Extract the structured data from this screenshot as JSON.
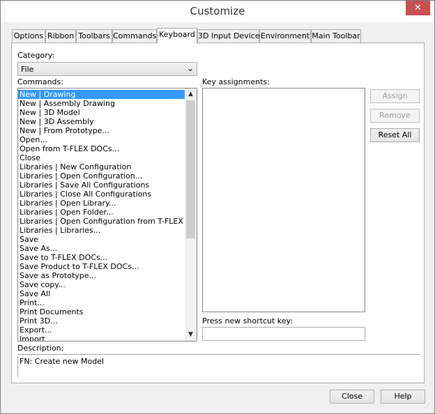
{
  "window": {
    "title": "Customize",
    "close_glyph": "✕"
  },
  "tabs": [
    {
      "label": "Options"
    },
    {
      "label": "Ribbon"
    },
    {
      "label": "Toolbars"
    },
    {
      "label": "Commands"
    },
    {
      "label": "Keyboard"
    },
    {
      "label": "3D Input Device"
    },
    {
      "label": "Environment"
    },
    {
      "label": "Main Toolbar"
    }
  ],
  "active_tab": "Keyboard",
  "category": {
    "label": "Category:",
    "value": "File"
  },
  "commands": {
    "label": "Commands:",
    "items": [
      "New | Drawing",
      "New | Assembly Drawing",
      "New | 3D Model",
      "New | 3D Assembly",
      "New | From Prototype...",
      "Open...",
      "Open from T-FLEX DOCs...",
      "Close",
      "Libraries | New Configuration",
      "Libraries | Open Configuration...",
      "Libraries | Save All Configurations",
      "Libraries | Close All Configurations",
      "Libraries | Open Library...",
      "Libraries | Open Folder...",
      "Libraries | Open Configuration from T-FLEX DOCs",
      "Libraries | Libraries...",
      "Save",
      "Save As...",
      "Save to T-FLEX DOCs...",
      "Save Product to T-FLEX DOCs...",
      "Save as Prototype...",
      "Save copy...",
      "Save All",
      "Print...",
      "Print Documents",
      "Print 3D...",
      "Export...",
      "Import"
    ],
    "selected_index": 0
  },
  "key_assignments": {
    "label": "Key assignments:"
  },
  "shortcut": {
    "label": "Press new shortcut key:",
    "value": ""
  },
  "buttons": {
    "assign": "Assign",
    "remove": "Remove",
    "reset_all": "Reset All",
    "close": "Close",
    "help": "Help"
  },
  "description": {
    "label": "Description:",
    "text": "FN: Create new Model"
  }
}
